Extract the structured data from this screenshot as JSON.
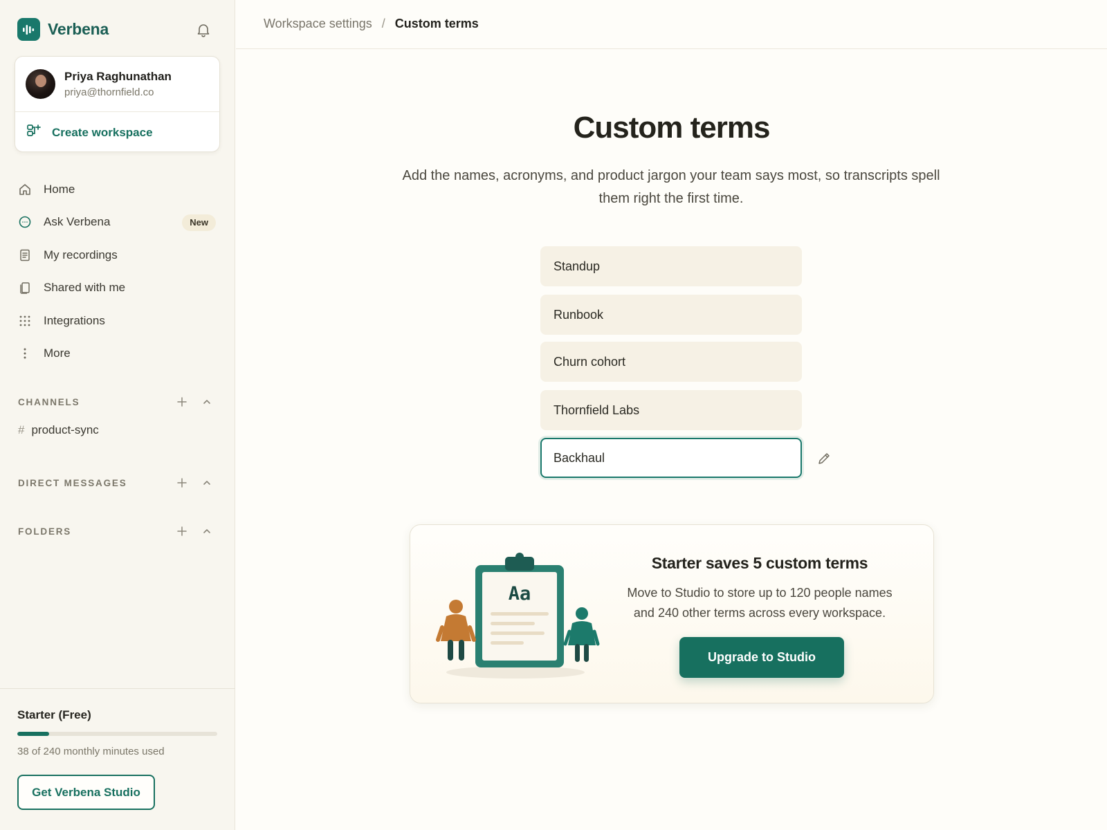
{
  "brand": {
    "name": "Verbena"
  },
  "profile": {
    "name": "Priya Raghunathan",
    "email": "priya@thornfield.co",
    "create_workspace_label": "Create workspace"
  },
  "nav": {
    "items": [
      {
        "label": "Home",
        "icon": "home-icon"
      },
      {
        "label": "Ask Verbena",
        "icon": "chat-icon",
        "badge": "New"
      },
      {
        "label": "My recordings",
        "icon": "document-icon"
      },
      {
        "label": "Shared with me",
        "icon": "copy-icon"
      },
      {
        "label": "Integrations",
        "icon": "grid-icon"
      },
      {
        "label": "More",
        "icon": "more-vertical-icon"
      }
    ]
  },
  "sections": {
    "channels": {
      "title": "CHANNELS",
      "items": [
        {
          "prefix": "#",
          "label": "product-sync"
        }
      ]
    },
    "direct_messages": {
      "title": "DIRECT MESSAGES"
    },
    "folders": {
      "title": "FOLDERS"
    }
  },
  "plan": {
    "name": "Starter (Free)",
    "usage_text": "38 of 240 monthly minutes used",
    "minutes_used": 38,
    "minutes_total": 240,
    "cta_label": "Get Verbena Studio"
  },
  "breadcrumb": {
    "parent": "Workspace settings",
    "separator": "/",
    "current": "Custom terms"
  },
  "page": {
    "title": "Custom terms",
    "subtitle": "Add the names, acronyms, and product jargon your team says most, so transcripts spell them right the first time."
  },
  "terms": [
    {
      "value": "Standup",
      "active": false
    },
    {
      "value": "Runbook",
      "active": false
    },
    {
      "value": "Churn cohort",
      "active": false
    },
    {
      "value": "Thornfield Labs",
      "active": false
    },
    {
      "value": "Backhaul",
      "active": true
    }
  ],
  "promo": {
    "illustration_text": "Aa",
    "title": "Starter saves 5 custom terms",
    "text": "Move to Studio to store up to 120 people names and 240 other terms across every workspace.",
    "cta_label": "Upgrade to Studio"
  },
  "colors": {
    "accent": "#17705f",
    "sidebar_bg": "#f8f6ef",
    "input_bg": "#f6f1e5",
    "badge_bg": "#f3ecd9",
    "illustration_orange": "#c47a33",
    "illustration_teal": "#1c7a6b"
  }
}
